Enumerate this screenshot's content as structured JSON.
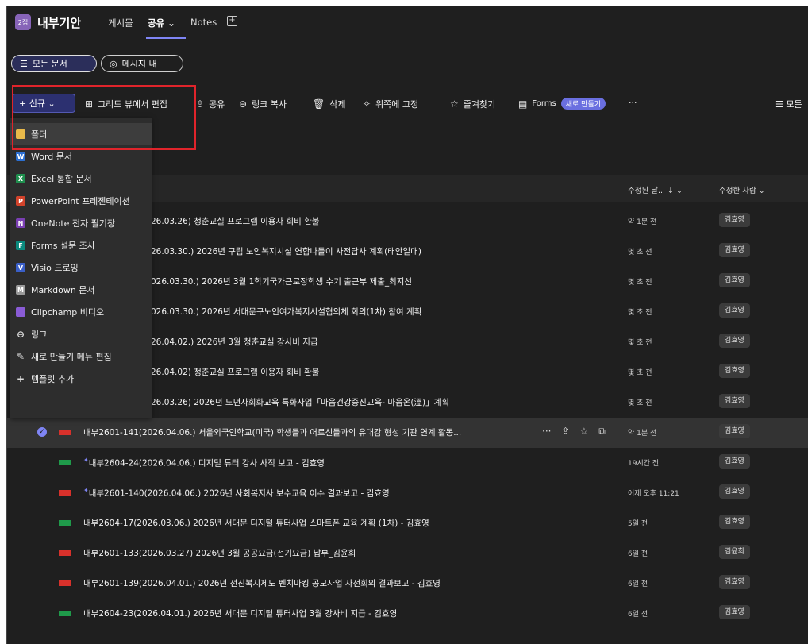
{
  "team": {
    "badge": "2접",
    "name": "내부기안"
  },
  "top_tabs": [
    {
      "label": "게시물"
    },
    {
      "label": "공유 ⌄"
    },
    {
      "label": "Notes"
    }
  ],
  "add_tab": "+",
  "pills": [
    {
      "icon": "☰",
      "label": "모든 문서"
    },
    {
      "icon": "◎",
      "label": "메시지 내"
    }
  ],
  "toolbar": {
    "new_label": "+ 신규 ⌄",
    "grid_edit": "그리드 뷰에서 편집",
    "share": "공유",
    "copy_link": "링크 복사",
    "delete": "삭제",
    "pin": "위쪽에 고정",
    "favorite": "즐겨찾기",
    "forms": "Forms",
    "forms_badge": "새로 만들기",
    "more": "···",
    "view_label": "☰ 모든"
  },
  "new_menu": [
    {
      "label": "폴더",
      "icon": "folder-icon",
      "color": "#e8b94a"
    },
    {
      "label": "Word 문서",
      "icon": "word-icon",
      "color": "#2b6fd1",
      "letter": "W"
    },
    {
      "label": "Excel 통합 문서",
      "icon": "excel-icon",
      "color": "#1f8f4e",
      "letter": "X"
    },
    {
      "label": "PowerPoint 프레젠테이션",
      "icon": "powerpoint-icon",
      "color": "#d2432b",
      "letter": "P"
    },
    {
      "label": "OneNote 전자 필기장",
      "icon": "onenote-icon",
      "color": "#7a3fb3",
      "letter": "N"
    },
    {
      "label": "Forms 설문 조사",
      "icon": "forms-icon",
      "color": "#0b8a7e",
      "letter": "F"
    },
    {
      "label": "Visio 드로잉",
      "icon": "visio-icon",
      "color": "#3a5fc8",
      "letter": "V"
    },
    {
      "label": "Markdown 문서",
      "icon": "markdown-icon",
      "color": "#9a9a9a",
      "letter": "M"
    },
    {
      "label": "Clipchamp 비디오",
      "icon": "clipchamp-icon",
      "color": "#8a5cd6",
      "letter": ""
    },
    {
      "label": "링크",
      "icon": "link-icon",
      "color": "",
      "letter": "⊖"
    },
    {
      "label": "새로 만들기 메뉴 편집",
      "icon": "edit-icon",
      "color": "",
      "letter": "✎"
    },
    {
      "label": "템플릿 추가",
      "icon": "plus-icon",
      "color": "",
      "letter": "+"
    }
  ],
  "columns": {
    "modified": "수정된 날... ↓ ⌄",
    "modified_by": "수정한 사람 ⌄"
  },
  "rows": [
    {
      "title": "26.03.26) 청춘교실 프로그램 이용자 회비 환불",
      "modified": "약 1분 전",
      "by": "김효영",
      "file_color": "",
      "new": false
    },
    {
      "title": "26.03.30.) 2026년 구립 노인복지시설 연합나들이 사전답사 계획(태안일대)",
      "modified": "몇 초 전",
      "by": "김효영",
      "file_color": "",
      "new": false
    },
    {
      "title": "026.03.30.) 2026년 3월 1학기국가근로장학생 수기 출근부 제출_최지선",
      "modified": "몇 초 전",
      "by": "김효영",
      "file_color": "",
      "new": false
    },
    {
      "title": "026.03.30.) 2026년 서대문구노인여가복지시설협의체 회의(1차) 참여 계획",
      "modified": "몇 초 전",
      "by": "김효영",
      "file_color": "",
      "new": false
    },
    {
      "title": "26.04.02.) 2026년 3월 청춘교실 강사비 지급",
      "modified": "몇 초 전",
      "by": "김효영",
      "file_color": "",
      "new": false
    },
    {
      "title": "26.04.02) 청춘교실 프로그램 이용자 회비 환불",
      "modified": "몇 초 전",
      "by": "김효영",
      "file_color": "",
      "new": false
    },
    {
      "title": "26.03.26) 2026년 노년사회화교육 특화사업「마음건강증진교육- 마음온(溫)」계획",
      "modified": "몇 초 전",
      "by": "김효영",
      "file_color": "",
      "new": false
    },
    {
      "title": "내부2601-141(2026.04.06.) 서울외국인학교(미국) 학생들과 어르신들과의 유대감 형성 기관 연계 활동...",
      "modified": "약 1분 전",
      "by": "김효영",
      "file_color": "#d8312b",
      "new": false,
      "selected": true
    },
    {
      "title": "내부2604-24(2026.04.06.) 디지털 튜터 강사 사직 보고 - 김효영",
      "modified": "19시간 전",
      "by": "김효영",
      "file_color": "#1f9a4a",
      "new": true
    },
    {
      "title": "내부2601-140(2026.04.06.) 2026년 사회복지사 보수교육 이수 결과보고 - 김효영",
      "modified": "어제 오후 11:21",
      "by": "김효영",
      "file_color": "#d8312b",
      "new": true
    },
    {
      "title": "내부2604-17(2026.03.06.) 2026년 서대문 디지털 튜터사업 스마트폰 교육 계획 (1차) - 김효영",
      "modified": "5일 전",
      "by": "김효영",
      "file_color": "#1f9a4a",
      "new": false
    },
    {
      "title": "내부2601-133(2026.03.27) 2026년 3월 공공요금(전기요금) 납부_김윤희",
      "modified": "6일 전",
      "by": "김윤희",
      "file_color": "#d8312b",
      "new": false
    },
    {
      "title": "내부2601-139(2026.04.01.) 2026년 선진복지제도 벤치마킹 공모사업 사전회의 결과보고 - 김효영",
      "modified": "6일 전",
      "by": "김효영",
      "file_color": "#d8312b",
      "new": false
    },
    {
      "title": "내부2604-23(2026.04.01.) 2026년 서대문 디지털 튜터사업 3월 강사비 지급 - 김효영",
      "modified": "6일 전",
      "by": "김효영",
      "file_color": "#1f9a4a",
      "new": false
    }
  ],
  "selected_row_actions": [
    "···",
    "⇪",
    "☆",
    "⧉"
  ],
  "colors": {
    "accent": "#7f85f5",
    "highlight_box": "#e0242b",
    "background": "#1f1f1f"
  }
}
